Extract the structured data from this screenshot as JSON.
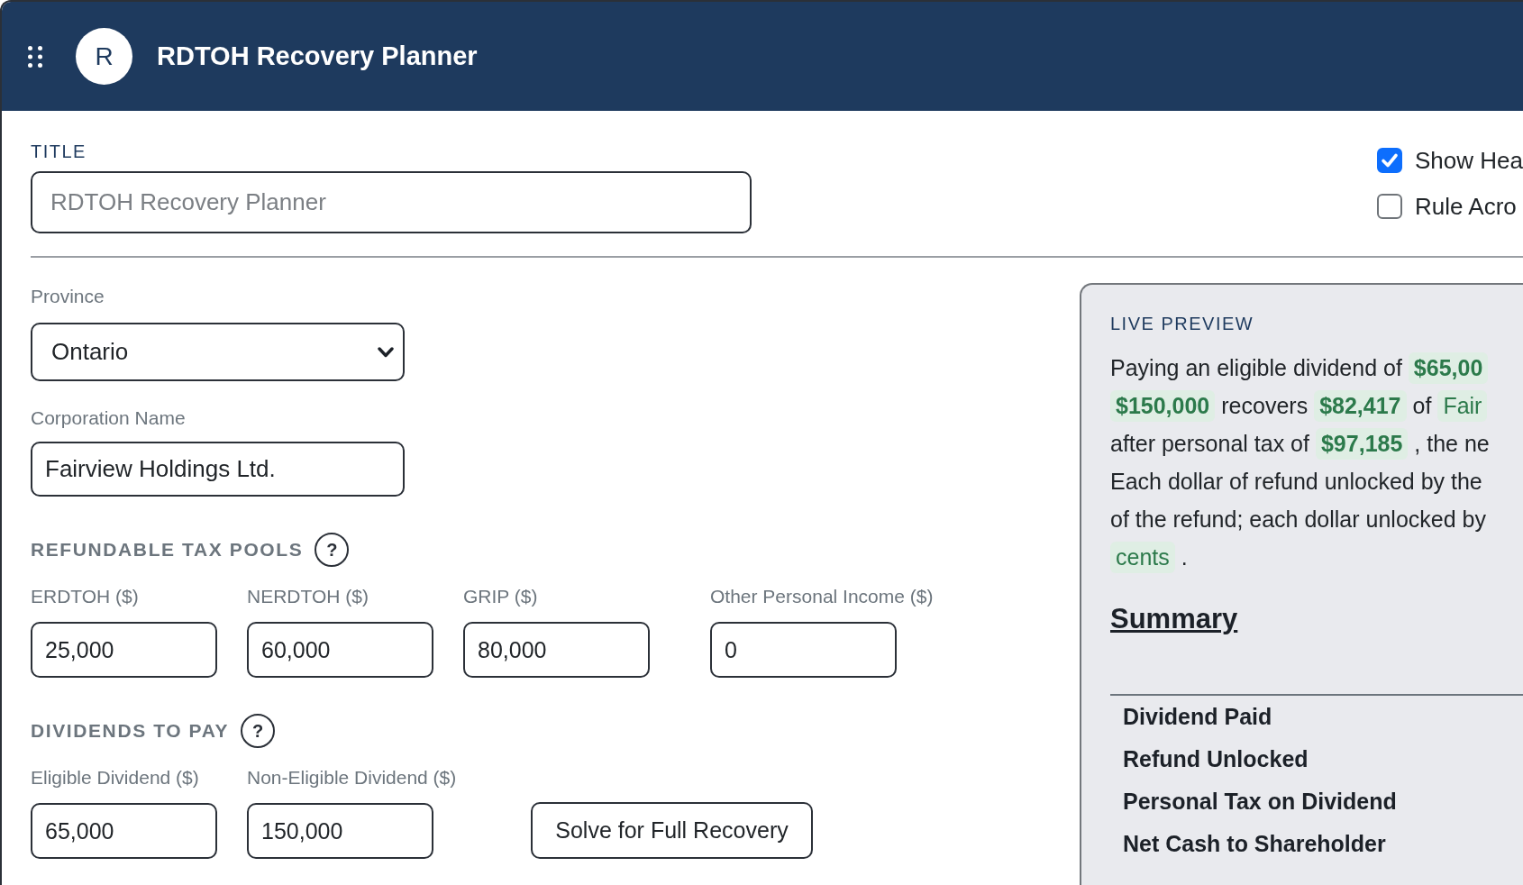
{
  "header": {
    "avatar": "R",
    "title": "RDTOH Recovery Planner"
  },
  "title_field": {
    "label": "TITLE",
    "placeholder": "RDTOH Recovery Planner"
  },
  "options": [
    {
      "label": "Show Hea",
      "checked": true
    },
    {
      "label": "Rule Acro",
      "checked": false
    }
  ],
  "province": {
    "label": "Province",
    "value": "Ontario"
  },
  "corporation": {
    "label": "Corporation Name",
    "value": "Fairview Holdings Ltd."
  },
  "sections": [
    {
      "title": "REFUNDABLE TAX POOLS",
      "help": "?",
      "fields": [
        {
          "label": "ERDTOH ($)",
          "value": "25,000"
        },
        {
          "label": "NERDTOH ($)",
          "value": "60,000"
        },
        {
          "label": "GRIP ($)",
          "value": "80,000"
        },
        {
          "label": "Other Personal Income ($)",
          "value": "0"
        }
      ]
    },
    {
      "title": "DIVIDENDS TO PAY",
      "help": "?",
      "fields": [
        {
          "label": "Eligible Dividend ($)",
          "value": "65,000"
        },
        {
          "label": "Non-Eligible Dividend ($)",
          "value": "150,000"
        }
      ],
      "button": "Solve for Full Recovery"
    }
  ],
  "preview": {
    "title": "LIVE PREVIEW",
    "lines": [
      [
        {
          "kind": "text",
          "text": "Paying an eligible dividend of"
        },
        {
          "kind": "amount",
          "text": "$65,00"
        }
      ],
      [
        {
          "kind": "amount",
          "text": "$150,000"
        },
        {
          "kind": "text",
          "text": "recovers"
        },
        {
          "kind": "amount",
          "text": "$82,417"
        },
        {
          "kind": "text",
          "text": "of"
        },
        {
          "kind": "term",
          "text": "Fair"
        }
      ],
      [
        {
          "kind": "text",
          "text": "after personal tax of"
        },
        {
          "kind": "amount",
          "text": "$97,185"
        },
        {
          "kind": "text",
          "text": ", the ne"
        }
      ],
      [
        {
          "kind": "text",
          "text": "Each dollar of refund unlocked by the"
        }
      ],
      [
        {
          "kind": "text",
          "text": "of the refund; each dollar unlocked by"
        }
      ],
      [
        {
          "kind": "term",
          "text": "cents"
        },
        {
          "kind": "text",
          "text": "."
        }
      ]
    ],
    "summary": {
      "title": "Summary",
      "rows": [
        "Dividend Paid",
        "Refund Unlocked",
        "Personal Tax on Dividend",
        "Net Cash to Shareholder"
      ]
    }
  }
}
